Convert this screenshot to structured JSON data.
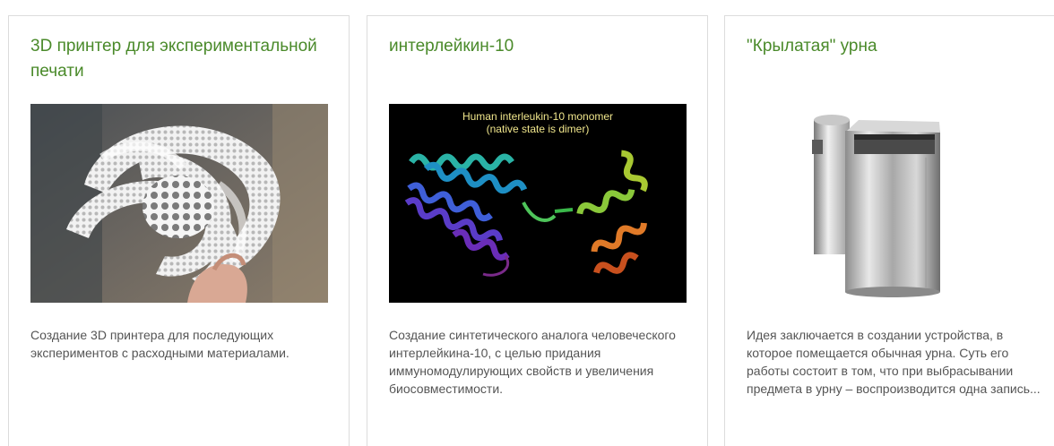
{
  "cards": [
    {
      "title": "3D принтер для экспериментальной печати",
      "description": "Создание 3D принтера для последующих экспериментов с расходными материалами.",
      "image_subject": "white 3D-printed lattice sculpture held in hand"
    },
    {
      "title": "интерлейкин-10",
      "description": "Создание синтетического аналога человеческого интерлейкина-10, с целью придания иммуномодулирующих свойств и увеличения биосовместимости.",
      "image_subject": "protein ribbon structure",
      "image_caption_line1": "Human interleukin-10 monomer",
      "image_caption_line2": "(native state is dimer)"
    },
    {
      "title": "\"Крылатая\" урна",
      "description": "Идея заключается в создании устройства, в которое помещается обычная урна. Суть его работы состоит в том, что при выбрасывании предмета в урну – воспроизводится одна запись...",
      "image_subject": "stainless steel cylindrical trash bin"
    }
  ],
  "colors": {
    "title": "#4a8a2a",
    "text": "#555555",
    "border": "#dcdcdc"
  }
}
